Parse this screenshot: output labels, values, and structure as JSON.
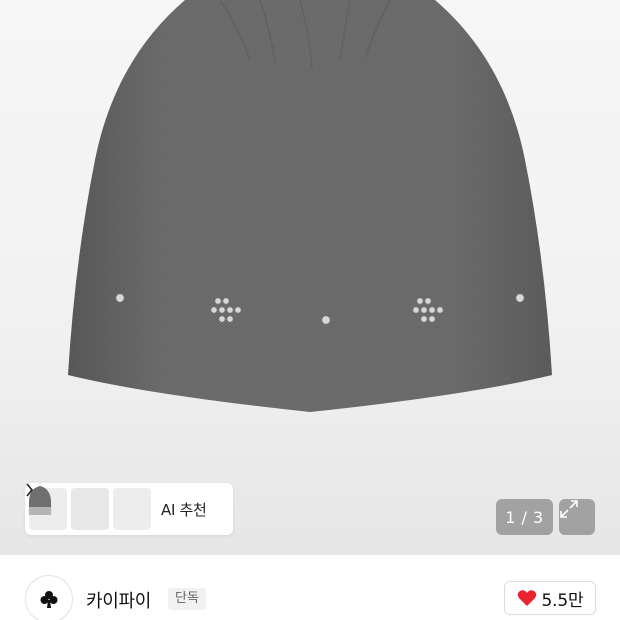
{
  "product_image": {
    "alt": "",
    "icon": "beanie-image"
  },
  "ai_recommend": {
    "label": "AI 추천",
    "chevron_icon": "chevron-right-icon"
  },
  "pager": {
    "current": "1",
    "total": "3",
    "separator": " / ",
    "text": "1 / 3"
  },
  "expand": {
    "icon": "expand-icon"
  },
  "store": {
    "name": "카이파이",
    "badge": "단독",
    "logo_icon": "club-icon"
  },
  "like": {
    "count": "5.5만",
    "icon": "heart-icon",
    "color": "#e8232d"
  }
}
